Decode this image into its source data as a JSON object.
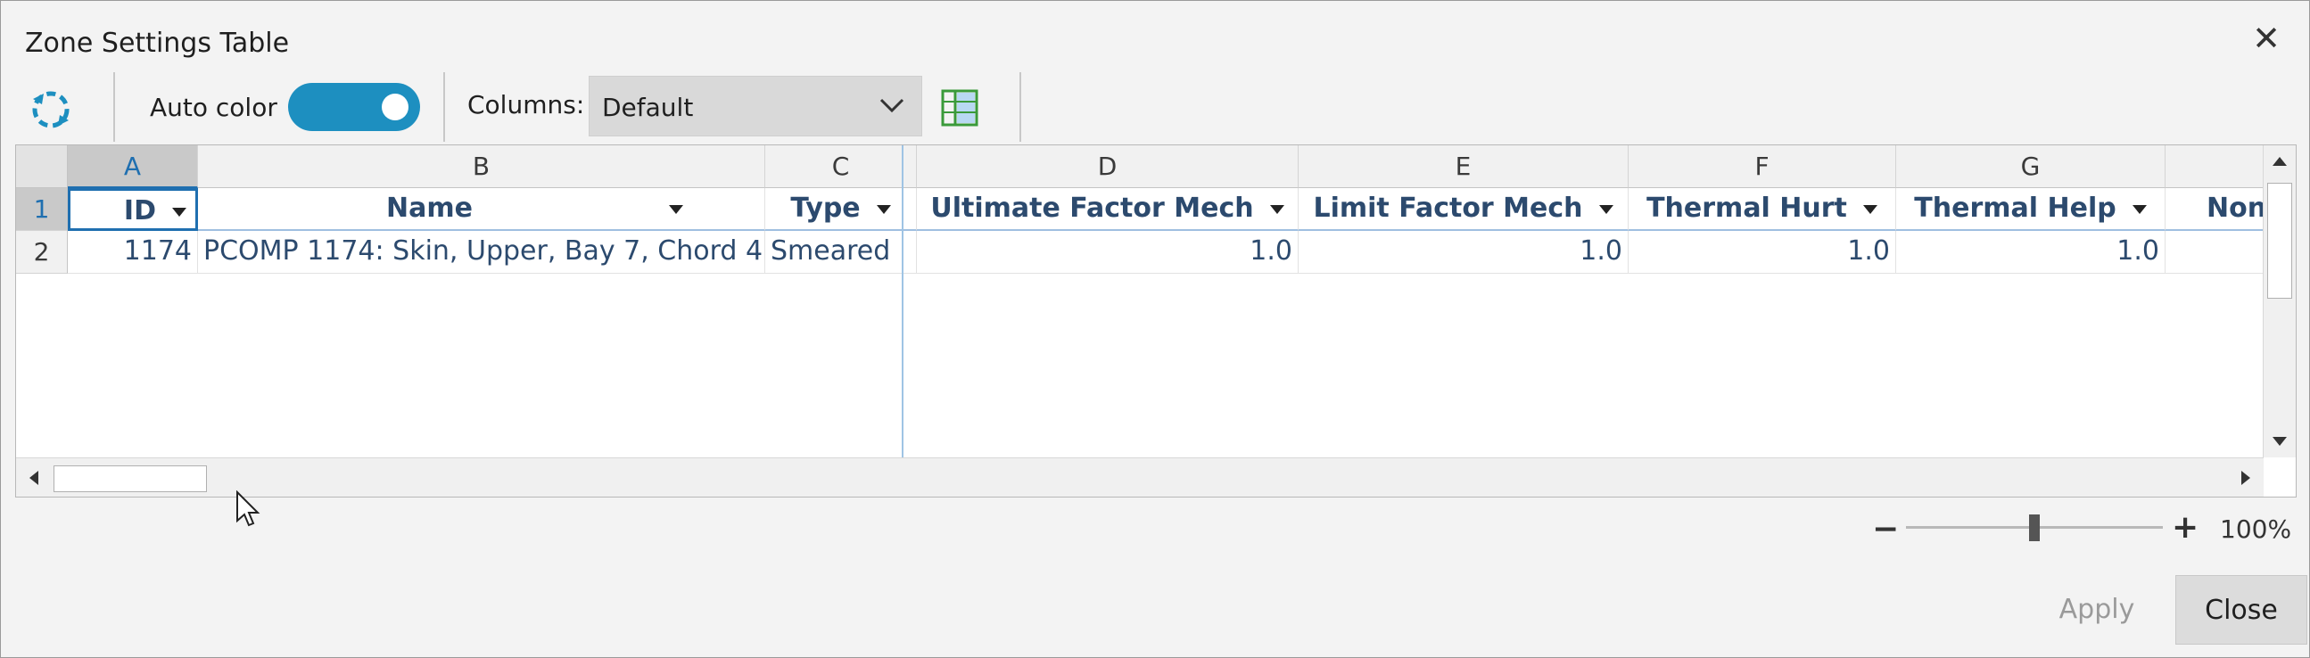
{
  "window": {
    "title": "Zone Settings Table"
  },
  "toolbar": {
    "auto_color_label": "Auto color",
    "auto_color_on": true,
    "columns_label": "Columns:",
    "columns_value": "Default"
  },
  "sheet": {
    "col_letters": [
      "A",
      "B",
      "C",
      "D",
      "E",
      "F",
      "G"
    ],
    "row_numbers": [
      "1",
      "2"
    ],
    "headers": [
      "ID",
      "Name",
      "Type",
      "Ultimate Factor Mech",
      "Limit Factor Mech",
      "Thermal Hurt",
      "Thermal Help",
      "Non"
    ],
    "rows": [
      [
        "1174",
        "PCOMP 1174: Skin, Upper, Bay 7, Chord 4",
        "Smeared",
        "1.0",
        "1.0",
        "1.0",
        "1.0",
        ""
      ]
    ]
  },
  "zoom": {
    "minus": "−",
    "plus": "+",
    "level": "100%",
    "value": 0.5
  },
  "buttons": {
    "apply": "Apply",
    "close": "Close"
  },
  "colors": {
    "accent": "#1d8fc0",
    "header_text": "#2c4a6e",
    "selected": "#1f6fb0"
  }
}
